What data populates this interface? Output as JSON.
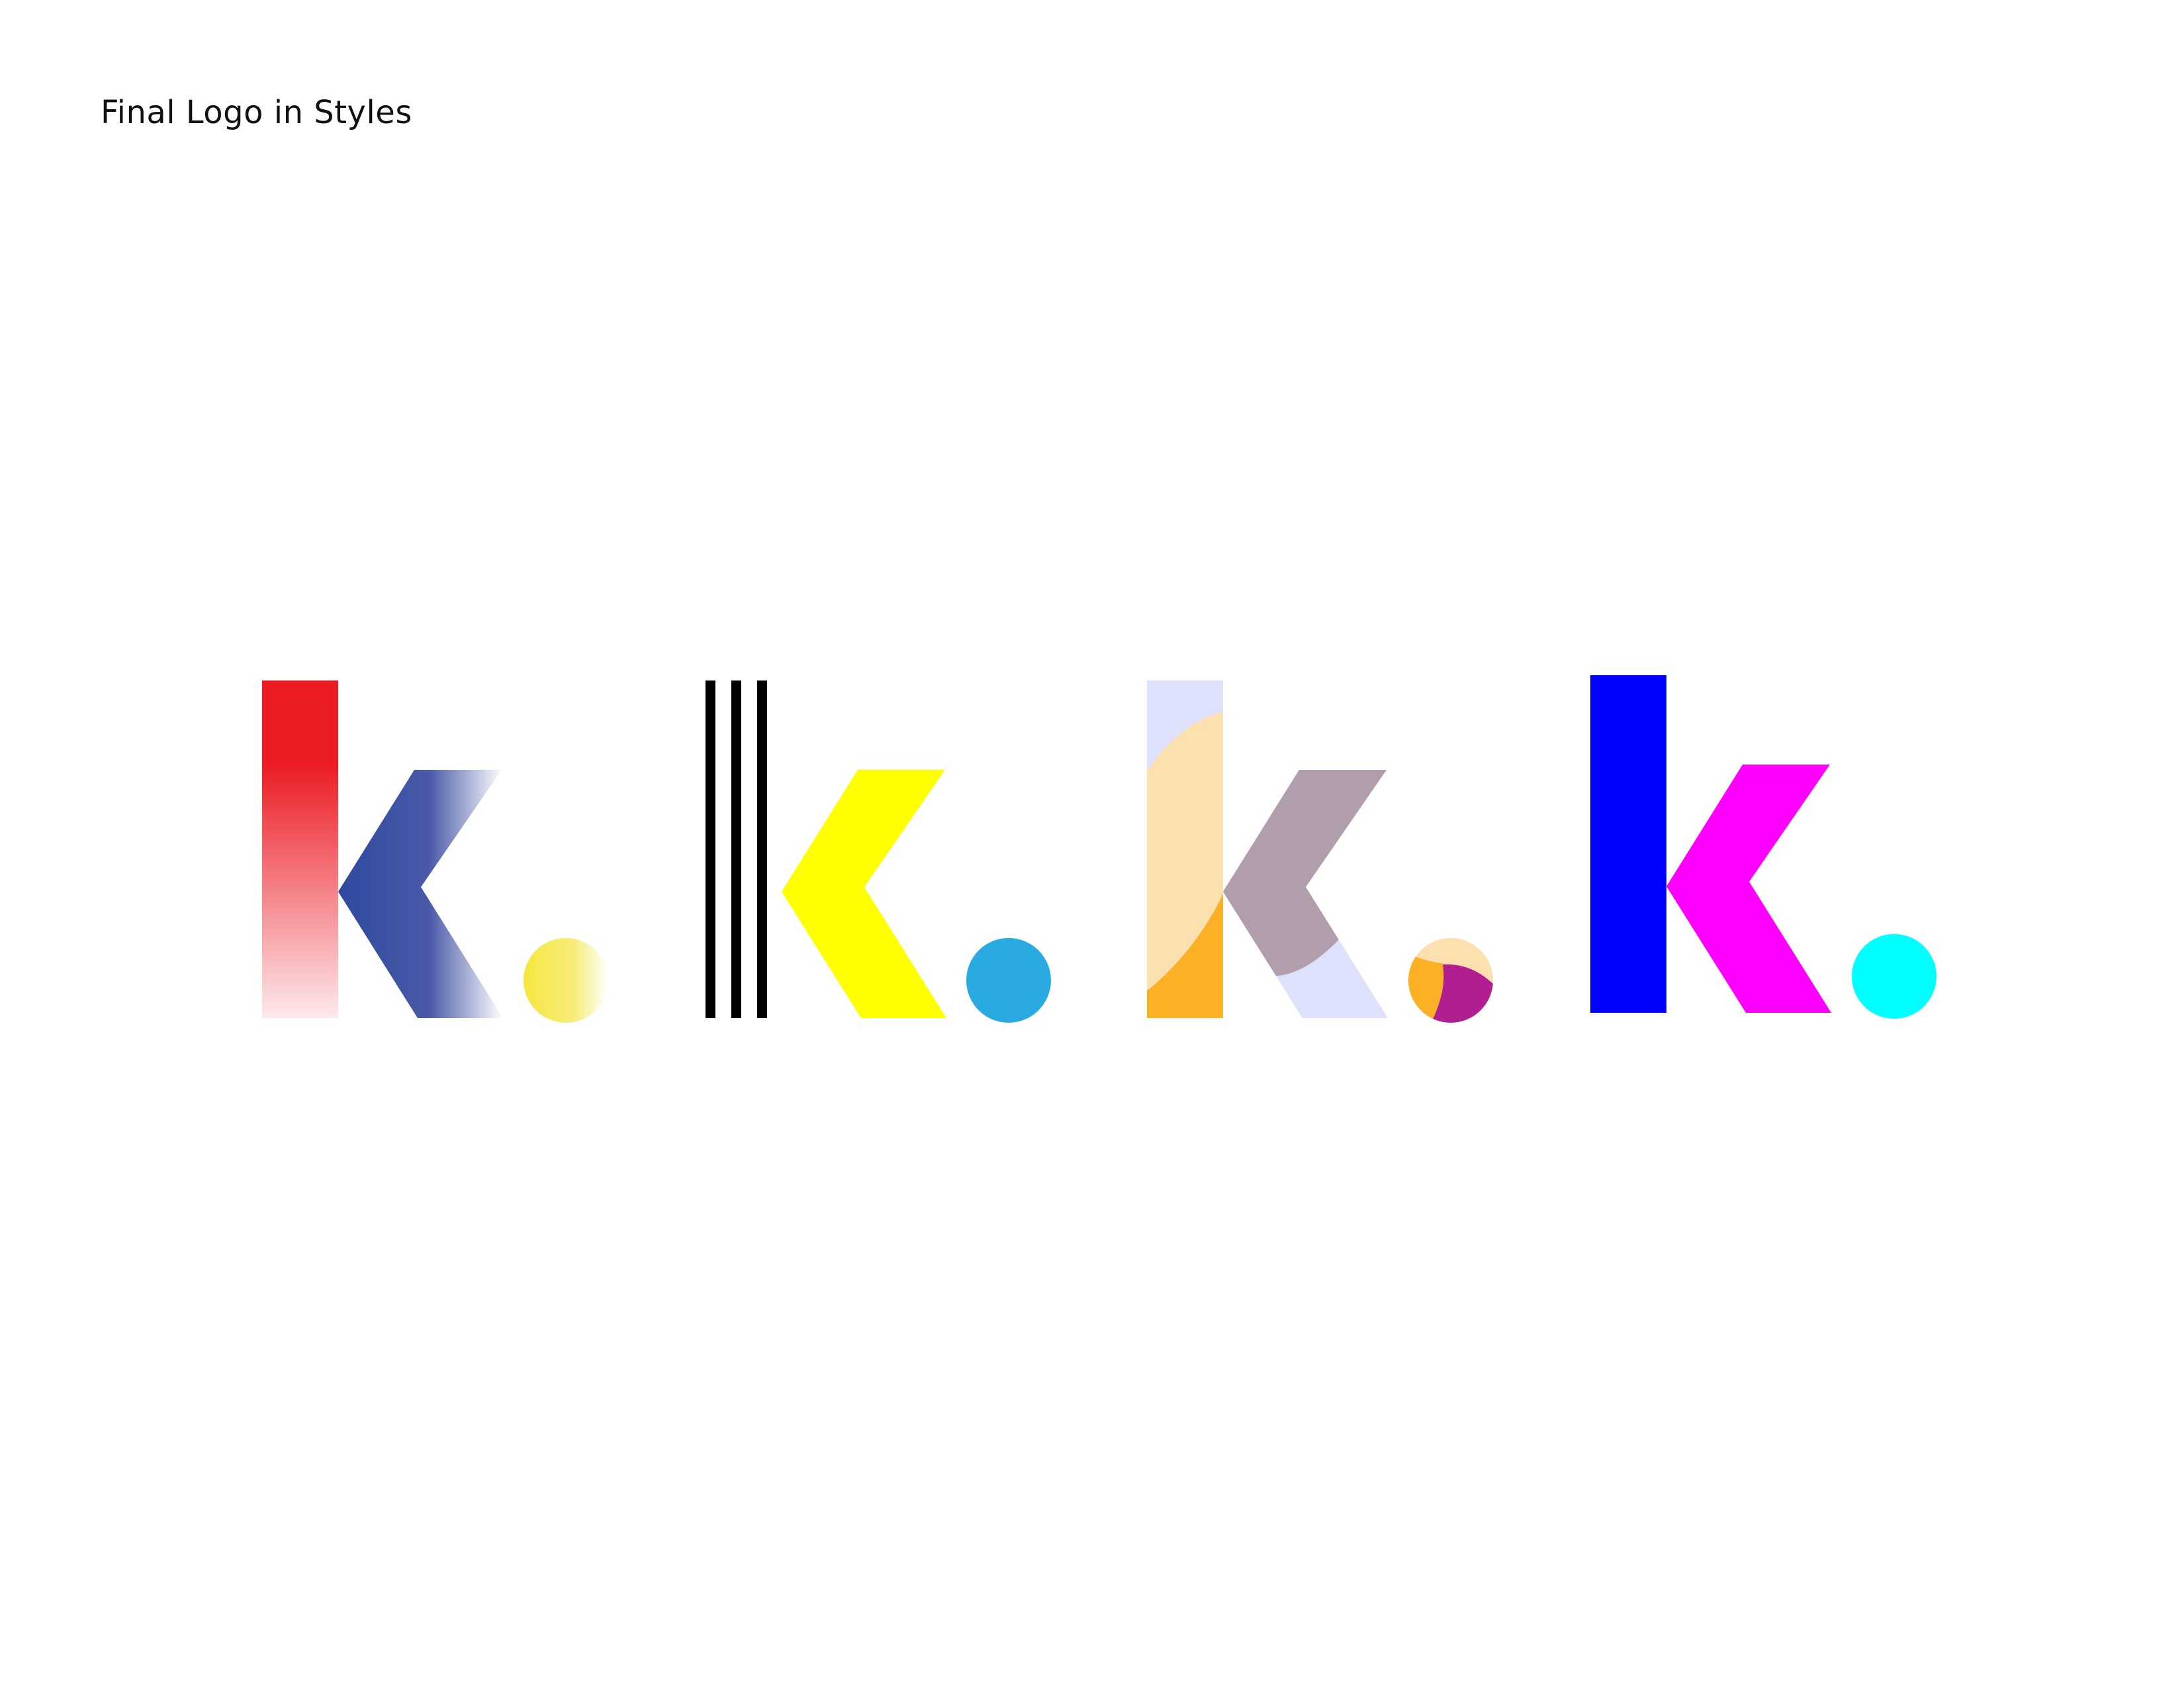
{
  "page": {
    "title": "Final Logo in Styles"
  },
  "logos": [
    {
      "style": "gradient",
      "stem_colors": [
        "#ec1c24",
        "#fde9ec"
      ],
      "arm_colors": [
        "#2e4a9e",
        "#ffffff"
      ],
      "dot_colors": [
        "#f5e63f",
        "#ffffff"
      ]
    },
    {
      "style": "striped",
      "stripe_color": "#000000",
      "arm_color": "#ffff00",
      "dot_color": "#29abe2"
    },
    {
      "style": "collage",
      "colors": [
        "#dde1fb",
        "#fde0b0",
        "#fbb025",
        "#b19ead",
        "#b01e8f"
      ]
    },
    {
      "style": "flat",
      "stem_color": "#0000ff",
      "arm_color": "#ff00ff",
      "dot_color": "#00ffff"
    }
  ]
}
